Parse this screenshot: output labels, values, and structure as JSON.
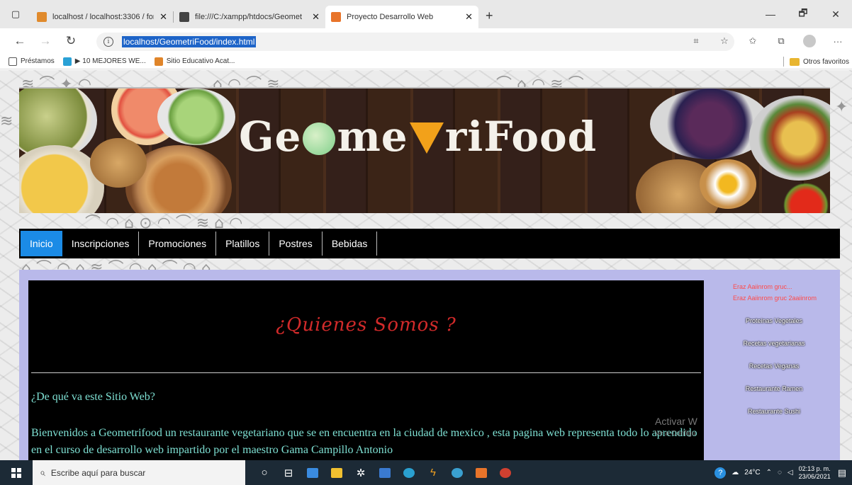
{
  "browser": {
    "tabs": [
      {
        "title": "localhost / localhost:3306 / form",
        "fav_color": "#e08a2c",
        "close": "✕"
      },
      {
        "title": "file:///C:/xampp/htdocs/Geomet",
        "fav_color": "#444444",
        "close": "✕"
      },
      {
        "title": "Proyecto Desarrollo Web",
        "fav_color": "#e8742a",
        "close": "✕"
      }
    ],
    "new_tab": "+",
    "window_controls": {
      "minimize": "—",
      "maximize": "🗗",
      "close": "✕"
    },
    "url": "localhost/GeometriFood/index.html",
    "nav": {
      "back": "←",
      "forward": "→",
      "reload": "↻"
    },
    "favorites": [
      {
        "label": "Préstamos",
        "icon_color": "#ffffff"
      },
      {
        "label": "▶ 10 MEJORES WE...",
        "icon_color": "#2aa1d6"
      },
      {
        "label": "Sitio Educativo Acat...",
        "icon_color": "#e0852a"
      }
    ],
    "other_favorites": "Otros favoritos",
    "menu": "···"
  },
  "site": {
    "brand": "GeometriFood",
    "brand_left": "Ge",
    "brand_mid": "me",
    "brand_right": "riFood",
    "nav": [
      {
        "label": "Inicio",
        "active": true
      },
      {
        "label": "Inscripciones",
        "active": false
      },
      {
        "label": "Promociones",
        "active": false
      },
      {
        "label": "Platillos",
        "active": false
      },
      {
        "label": "Postres",
        "active": false
      },
      {
        "label": "Bebidas",
        "active": false
      }
    ],
    "heading": "¿Quienes Somos ?",
    "subheading": "¿De qué va este Sitio Web?",
    "paragraph": "Bienvenidos a Geometrifood un restaurante vegetariano que se en encuentra en la ciudad de mexico , esta pagina web representa todo lo aprendido en el curso de desarrollo web impartido por el maestro Gama Campillo Antonio",
    "sidebar_notice_1": "Eraz Aaiinrom gruc...",
    "sidebar_notice_2": "Eraz Aaiinrom gruc 2aaiinrom",
    "sidebar_links": [
      "Proteinas Vegetales",
      "Recetas vegetarianas",
      "Recetas Veganas",
      "Restaurante Ramen",
      "Restaurante Sushi"
    ],
    "watermark_title": "Activar W",
    "watermark_sub": "Ve a Configu"
  },
  "taskbar": {
    "search_placeholder": "Escribe aquí para buscar",
    "weather": "24°C",
    "time": "02:13 p. m.",
    "date": "23/06/2021"
  }
}
